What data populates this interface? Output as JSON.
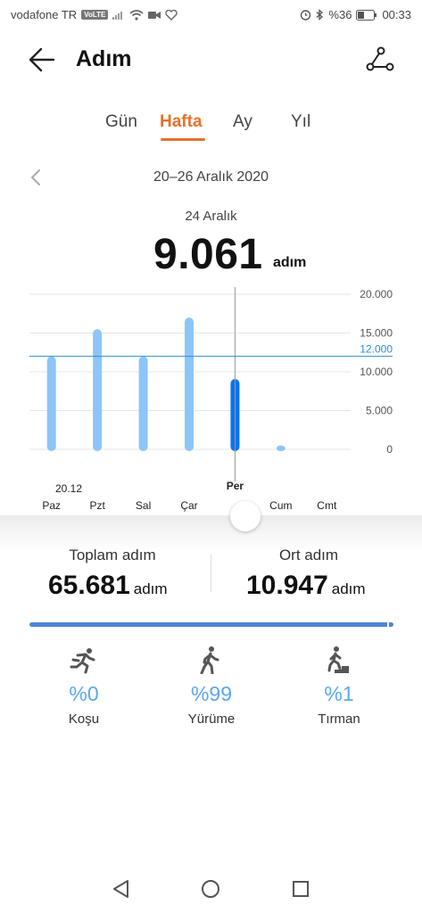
{
  "status": {
    "carrier": "vodafone TR",
    "volte": "VoLTE",
    "battery": "%36",
    "time": "00:33"
  },
  "header": {
    "title": "Adım"
  },
  "tabs": [
    {
      "label": "Gün"
    },
    {
      "label": "Hafta"
    },
    {
      "label": "Ay"
    },
    {
      "label": "Yıl"
    }
  ],
  "range_label": "20–26 Aralık 2020",
  "selected": {
    "date": "24 Aralık",
    "steps": "9.061",
    "unit": "adım"
  },
  "chart_data": {
    "type": "bar",
    "categories": [
      "Paz",
      "Pzt",
      "Sal",
      "Çar",
      "Per",
      "Cum",
      "Cmt"
    ],
    "first_date_label": "20.12",
    "values": [
      12000,
      15500,
      12000,
      17000,
      9061,
      500,
      0
    ],
    "highlighted_index": 4,
    "ylim": [
      0,
      20000
    ],
    "yticks": [
      "20.000",
      "15.000",
      "10.000",
      "5.000",
      "0"
    ],
    "yticks_values": [
      20000,
      15000,
      10000,
      5000,
      0
    ],
    "target_label": "12.000",
    "target_value": 12000,
    "colors": {
      "bar": "#8ec5f7",
      "highlight": "#0a74f0",
      "target": "#2a8fd6"
    }
  },
  "summary": {
    "total_label": "Toplam adım",
    "total_value": "65.681",
    "avg_label": "Ort adım",
    "avg_value": "10.947",
    "unit": "adım"
  },
  "activities": [
    {
      "icon": "running-icon",
      "pct": "%0",
      "label": "Koşu"
    },
    {
      "icon": "walking-icon",
      "pct": "%99",
      "label": "Yürüme"
    },
    {
      "icon": "climbing-icon",
      "pct": "%1",
      "label": "Tırman"
    }
  ]
}
